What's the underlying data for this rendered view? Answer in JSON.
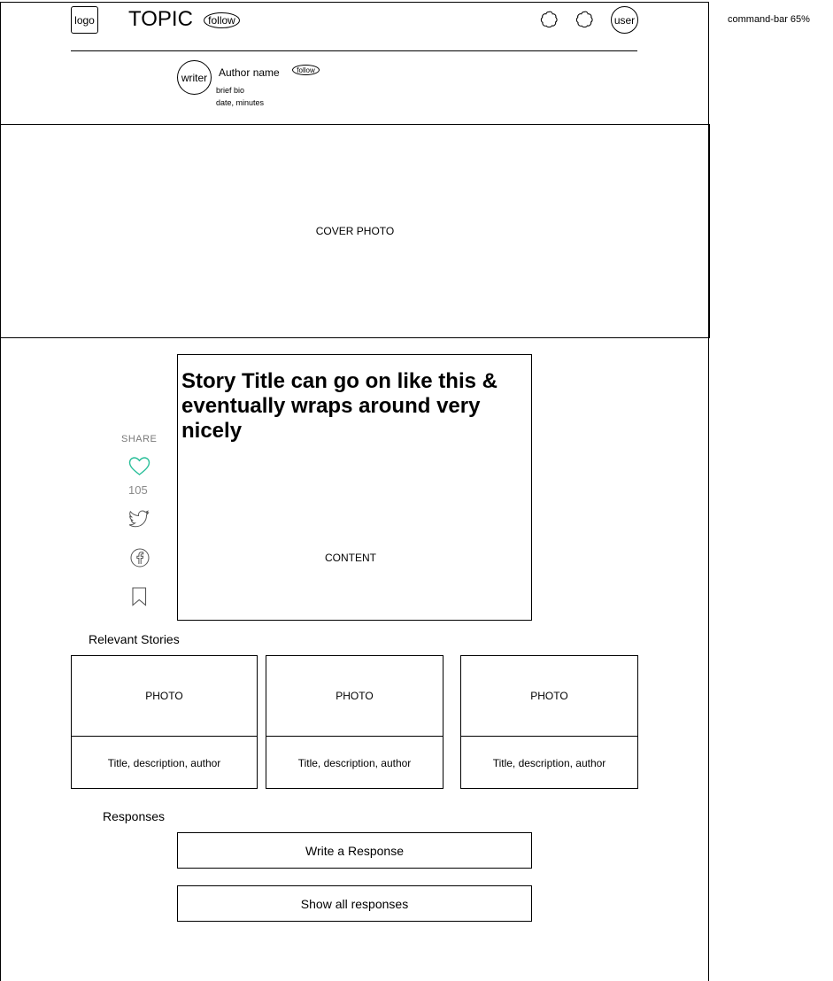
{
  "header": {
    "logo": "logo",
    "topic": "TOPIC",
    "topic_follow": "follow",
    "user": "user"
  },
  "author": {
    "avatar": "writer",
    "name": "Author name",
    "follow": "follow",
    "bio": "brief bio",
    "meta": "date, minutes"
  },
  "cover": {
    "label": "COVER PHOTO"
  },
  "share": {
    "label": "SHARE",
    "like_count": "105",
    "icons": [
      "heart-icon",
      "twitter-icon",
      "facebook-icon",
      "bookmark-icon"
    ],
    "heart_color": "#2bbf9a"
  },
  "story": {
    "title": "Story Title can go on like this & eventually wraps around very nicely",
    "content": "CONTENT"
  },
  "relevant": {
    "heading": "Relevant Stories",
    "cards": [
      {
        "photo": "PHOTO",
        "text": "Title, description, author"
      },
      {
        "photo": "PHOTO",
        "text": "Title, description, author"
      },
      {
        "photo": "PHOTO",
        "text": "Title, description, author"
      }
    ]
  },
  "responses": {
    "heading": "Responses",
    "write": "Write a Response",
    "show_all": "Show all responses"
  },
  "annotation": {
    "command_bar": "command-bar 65%"
  }
}
